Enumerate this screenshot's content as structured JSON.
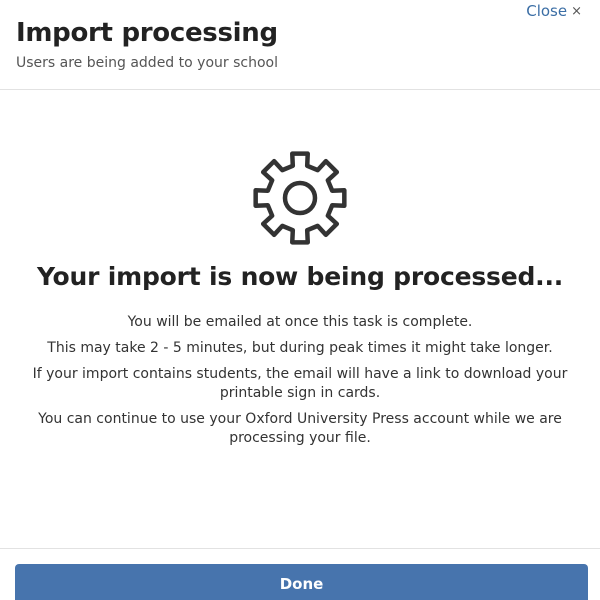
{
  "dialog": {
    "close_label": "Close",
    "close_icon": "×",
    "title": "Import processing",
    "subtitle": "Users are being added to your school"
  },
  "status": {
    "icon": "gear-icon",
    "heading": "Your import is now being processed...",
    "messages": [
      "You will be emailed at once this task is complete.",
      "This may take 2 - 5 minutes, but during peak times it might take longer.",
      "If your import contains students, the email will have a link to download your printable sign in cards.",
      "You can continue to use your Oxford University Press account while we are processing your file."
    ]
  },
  "footer": {
    "done_label": "Done"
  },
  "colors": {
    "accent": "#4774ad",
    "link": "#3b6ea5",
    "text": "#222222"
  }
}
